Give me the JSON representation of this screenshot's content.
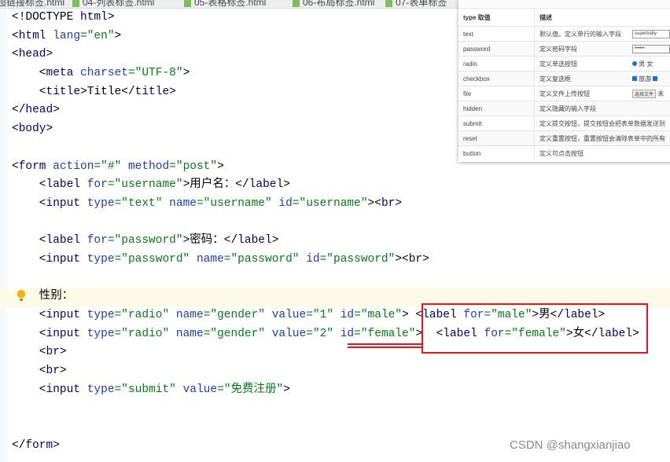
{
  "tabs": [
    "超链接标签.html",
    "04-列表标签.html",
    "05-表格标签.html",
    "06-布局标签.html",
    "07-表单标签"
  ],
  "code_lines": [
    [
      [
        "<!DOCTYPE ",
        "p"
      ],
      [
        "html",
        "t"
      ],
      [
        ">",
        "p"
      ]
    ],
    [
      [
        "<",
        "p"
      ],
      [
        "html ",
        "t"
      ],
      [
        "lang",
        "a"
      ],
      [
        "=\"en\"",
        "v"
      ],
      [
        ">",
        "p"
      ]
    ],
    [
      [
        "<",
        "p"
      ],
      [
        "head",
        "t"
      ],
      [
        ">",
        "p"
      ]
    ],
    [
      [
        "    <",
        "p"
      ],
      [
        "meta ",
        "t"
      ],
      [
        "charset",
        "a"
      ],
      [
        "=\"UTF-8\"",
        "v"
      ],
      [
        ">",
        "p"
      ]
    ],
    [
      [
        "    <",
        "p"
      ],
      [
        "title",
        "t"
      ],
      [
        ">Title</",
        "p"
      ],
      [
        "title",
        "t"
      ],
      [
        ">",
        "p"
      ]
    ],
    [
      [
        "</",
        "p"
      ],
      [
        "head",
        "t"
      ],
      [
        ">",
        "p"
      ]
    ],
    [
      [
        "<",
        "p"
      ],
      [
        "body",
        "t"
      ],
      [
        ">",
        "p"
      ]
    ],
    [],
    [
      [
        "<",
        "p"
      ],
      [
        "form ",
        "t"
      ],
      [
        "action",
        "a"
      ],
      [
        "=\"#\" ",
        "v"
      ],
      [
        "method",
        "a"
      ],
      [
        "=\"post\"",
        "v"
      ],
      [
        ">",
        "p"
      ]
    ],
    [
      [
        "    <",
        "p"
      ],
      [
        "label ",
        "t"
      ],
      [
        "for",
        "a"
      ],
      [
        "=\"username\"",
        "v"
      ],
      [
        ">用户名：</",
        "p"
      ],
      [
        "label",
        "t"
      ],
      [
        ">",
        "p"
      ]
    ],
    [
      [
        "    <",
        "p"
      ],
      [
        "input ",
        "t"
      ],
      [
        "type",
        "a"
      ],
      [
        "=\"text\" ",
        "v"
      ],
      [
        "name",
        "a"
      ],
      [
        "=\"username\" ",
        "v"
      ],
      [
        "id",
        "a"
      ],
      [
        "=\"username\"",
        "v"
      ],
      [
        "><",
        "p"
      ],
      [
        "br",
        "t"
      ],
      [
        ">",
        "p"
      ]
    ],
    [],
    [
      [
        "    <",
        "p"
      ],
      [
        "label ",
        "t"
      ],
      [
        "for",
        "a"
      ],
      [
        "=\"password\"",
        "v"
      ],
      [
        ">密码：</",
        "p"
      ],
      [
        "label",
        "t"
      ],
      [
        ">",
        "p"
      ]
    ],
    [
      [
        "    <",
        "p"
      ],
      [
        "input ",
        "t"
      ],
      [
        "type",
        "a"
      ],
      [
        "=\"password\" ",
        "v"
      ],
      [
        "name",
        "a"
      ],
      [
        "=\"password\" ",
        "v"
      ],
      [
        "id",
        "a"
      ],
      [
        "=\"password\"",
        "v"
      ],
      [
        "><",
        "p"
      ],
      [
        "br",
        "t"
      ],
      [
        ">",
        "p"
      ]
    ],
    [],
    [
      [
        "    性别：",
        "p"
      ]
    ],
    [
      [
        "    <",
        "p"
      ],
      [
        "input ",
        "t"
      ],
      [
        "type",
        "a"
      ],
      [
        "=\"radio\" ",
        "v"
      ],
      [
        "name",
        "a"
      ],
      [
        "=\"gender\" ",
        "v"
      ],
      [
        "value",
        "a"
      ],
      [
        "=\"1\" ",
        "v"
      ],
      [
        "id",
        "a"
      ],
      [
        "=\"male\"",
        "v"
      ],
      [
        "> <",
        "p"
      ],
      [
        "label ",
        "t"
      ],
      [
        "for",
        "a"
      ],
      [
        "=\"male\"",
        "v"
      ],
      [
        ">男</",
        "p"
      ],
      [
        "label",
        "t"
      ],
      [
        ">",
        "p"
      ]
    ],
    [
      [
        "    <",
        "p"
      ],
      [
        "input ",
        "t"
      ],
      [
        "type",
        "a"
      ],
      [
        "=\"radio\" ",
        "v"
      ],
      [
        "name",
        "a"
      ],
      [
        "=\"gender\" ",
        "v"
      ],
      [
        "value",
        "a"
      ],
      [
        "=\"2\" ",
        "v"
      ],
      [
        "id",
        "a"
      ],
      [
        "=\"female\"",
        "v"
      ],
      [
        ">  <",
        "p"
      ],
      [
        "label ",
        "t"
      ],
      [
        "for",
        "a"
      ],
      [
        "=\"female\"",
        "v"
      ],
      [
        ">女</",
        "p"
      ],
      [
        "label",
        "t"
      ],
      [
        ">",
        "p"
      ]
    ],
    [
      [
        "    <",
        "p"
      ],
      [
        "br",
        "t"
      ],
      [
        ">",
        "p"
      ]
    ],
    [
      [
        "    <",
        "p"
      ],
      [
        "br",
        "t"
      ],
      [
        ">",
        "p"
      ]
    ],
    [
      [
        "    <",
        "p"
      ],
      [
        "input ",
        "t"
      ],
      [
        "type",
        "a"
      ],
      [
        "=\"submit\" ",
        "v"
      ],
      [
        "value",
        "a"
      ],
      [
        "=\"免费注册\"",
        "v"
      ],
      [
        ">",
        "p"
      ]
    ],
    [],
    [],
    [
      [
        "</",
        "p"
      ],
      [
        "form",
        "t"
      ],
      [
        ">",
        "p"
      ]
    ]
  ],
  "reference_table": {
    "headers": [
      "type 取值",
      "描述"
    ],
    "rows": [
      {
        "type": "text",
        "desc": "默认值。定义单行的输入字段",
        "demo": "superbaby"
      },
      {
        "type": "password",
        "desc": "定义密码字段",
        "demo": "••••••"
      },
      {
        "type": "radio",
        "desc": "定义单选按钮",
        "demo": "男 女"
      },
      {
        "type": "checkbox",
        "desc": "定义复选框",
        "demo": "旅游"
      },
      {
        "type": "file",
        "desc": "定义文件上传按钮",
        "demo": "选择文件",
        "demo_extra": "未"
      },
      {
        "type": "hidden",
        "desc": "定义隐藏的输入字段"
      },
      {
        "type": "submit",
        "desc": "定义提交按钮，提交按钮会把表单数据发送到"
      },
      {
        "type": "reset",
        "desc": "定义重置按钮，重置按钮会清除表单中的所有"
      },
      {
        "type": "button",
        "desc": "定义可点击按钮"
      }
    ]
  },
  "watermark": "CSDN @shangxianjiao",
  "colors": {
    "annotation": "#e8141c",
    "tag": "#000080",
    "attribute": "#1a3cc8",
    "value": "#067d17"
  }
}
